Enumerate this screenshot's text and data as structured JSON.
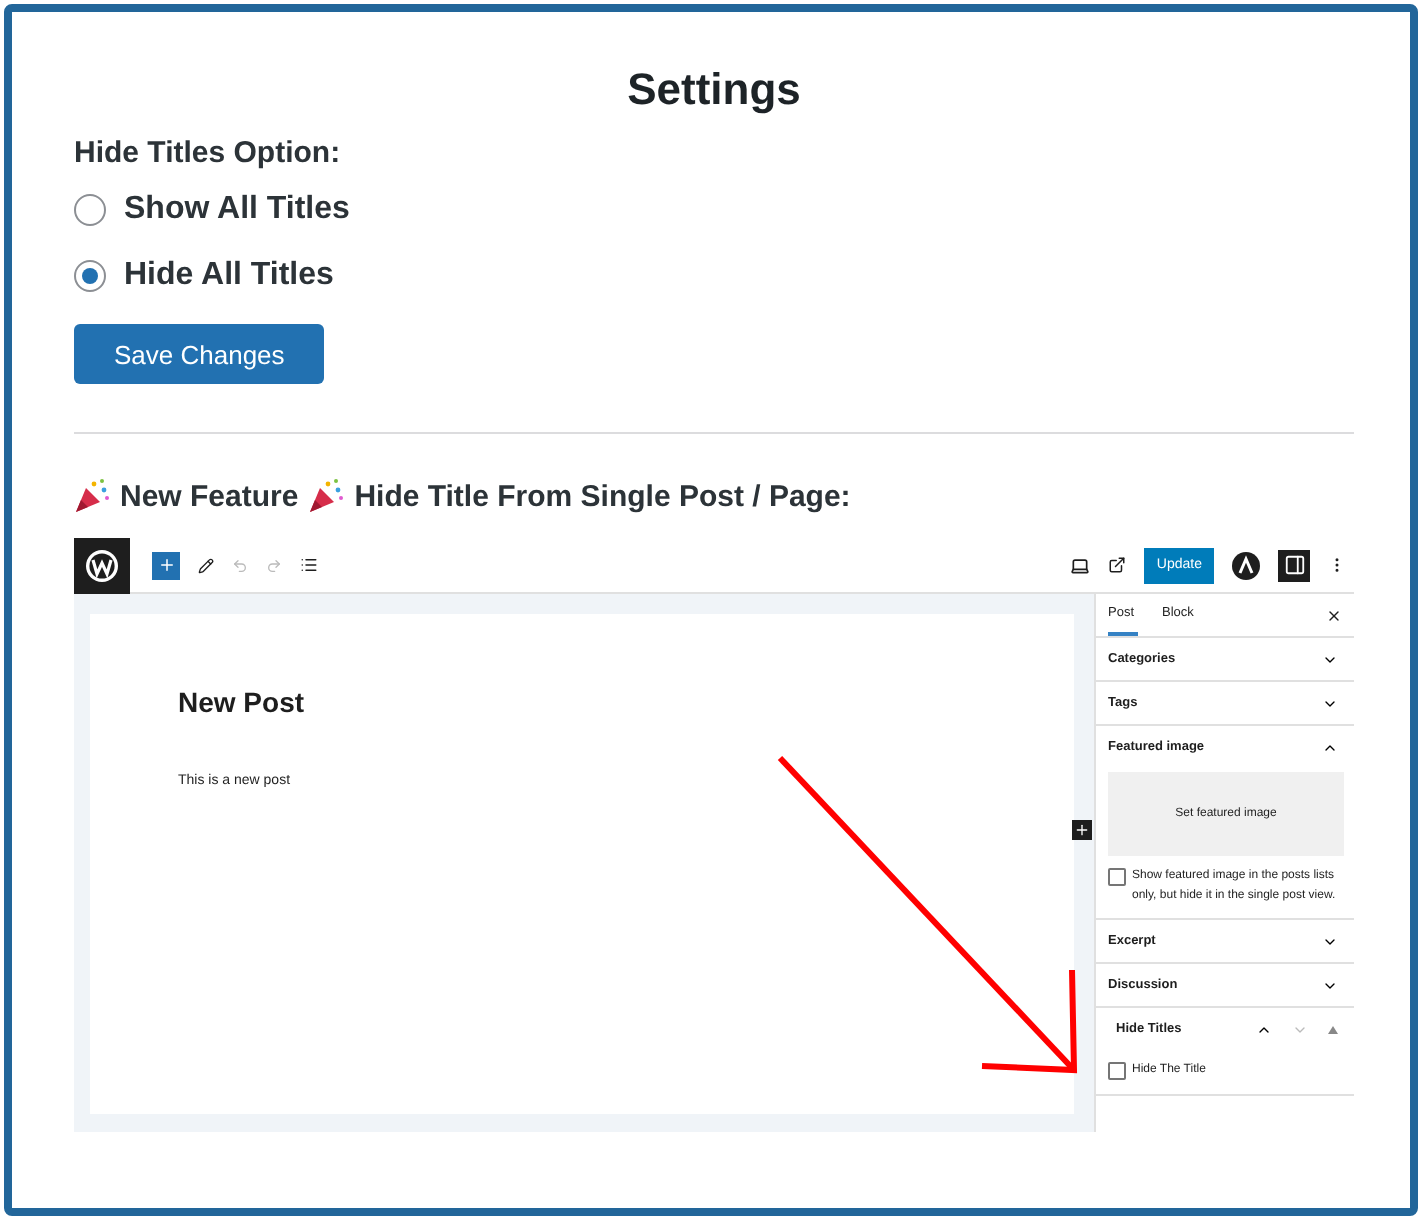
{
  "title": "Settings",
  "option_group": {
    "label": "Hide Titles Option:",
    "options": [
      {
        "label": "Show All Titles",
        "selected": false
      },
      {
        "label": "Hide All Titles",
        "selected": true
      }
    ]
  },
  "save_button": "Save Changes",
  "feature_heading": {
    "parts": [
      "New Feature",
      "Hide Title From Single Post / Page:"
    ]
  },
  "editor_preview": {
    "update_button": "Update",
    "post_title": "New Post",
    "post_body": "This is a new post",
    "sidebar": {
      "tabs": [
        {
          "label": "Post",
          "selected": true
        },
        {
          "label": "Block",
          "selected": false
        }
      ],
      "panels": [
        {
          "kind": "section",
          "title": "Categories",
          "expanded": false
        },
        {
          "kind": "section",
          "title": "Tags",
          "expanded": false
        },
        {
          "kind": "image",
          "title": "Featured image",
          "expanded": true,
          "set_button": "Set featured image",
          "checkbox": {
            "label": "Show featured image in the posts lists only, but hide it in the single post view.",
            "checked": false
          }
        },
        {
          "kind": "section",
          "title": "Excerpt",
          "expanded": false
        },
        {
          "kind": "section",
          "title": "Discussion",
          "expanded": false
        },
        {
          "kind": "plugin",
          "title": "Hide Titles",
          "expanded": true,
          "checkbox": {
            "label": "Hide The Title",
            "checked": false
          }
        }
      ]
    }
  }
}
